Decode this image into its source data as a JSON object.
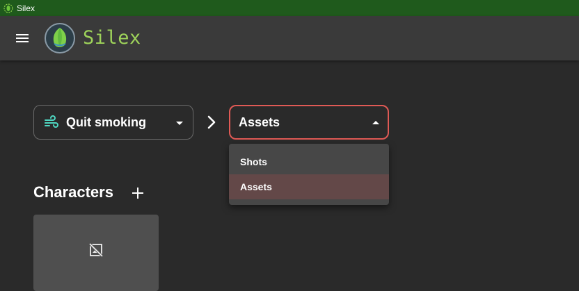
{
  "window": {
    "title": "Silex",
    "icon": "silex-leaf-icon"
  },
  "appbar": {
    "brand": "Silex",
    "menu_icon": "hamburger-menu-icon",
    "logo": "silex-logo"
  },
  "project_select": {
    "value": "Quit smoking",
    "icon": "wind-icon"
  },
  "category_select": {
    "value": "Assets",
    "open": true,
    "options": [
      "Shots",
      "Assets"
    ],
    "selected_index": 1
  },
  "section": {
    "title": "Characters",
    "add_icon": "plus-icon"
  },
  "cards": [
    {
      "thumbnail": "image-not-supported-icon"
    }
  ],
  "colors": {
    "titlebar": "#1f5a1c",
    "appbar": "#3a3a3a",
    "background": "#2a2a2a",
    "brand": "#9ed35a",
    "focus_border": "#e05a55",
    "selected_option": "#634848",
    "card": "#4f4f4f"
  }
}
